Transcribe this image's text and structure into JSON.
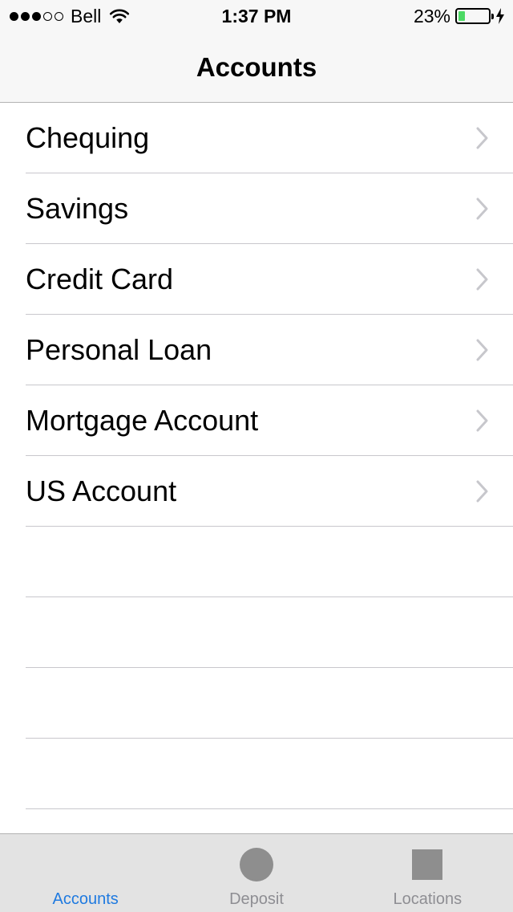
{
  "status_bar": {
    "carrier": "Bell",
    "time": "1:37 PM",
    "battery_percent": "23%",
    "battery_level": 0.23,
    "signal_bars_filled": 3,
    "signal_bars_total": 5,
    "battery_color": "#4cd964"
  },
  "nav": {
    "title": "Accounts"
  },
  "accounts": [
    {
      "label": "Chequing"
    },
    {
      "label": "Savings"
    },
    {
      "label": "Credit Card"
    },
    {
      "label": "Personal Loan"
    },
    {
      "label": "Mortgage Account"
    },
    {
      "label": "US Account"
    }
  ],
  "tabs": [
    {
      "label": "Accounts",
      "icon": "none",
      "active": true
    },
    {
      "label": "Deposit",
      "icon": "circle-icon",
      "active": false
    },
    {
      "label": "Locations",
      "icon": "square-icon",
      "active": false
    }
  ],
  "colors": {
    "accent": "#1f7ae0",
    "inactive": "#8e8e93"
  }
}
